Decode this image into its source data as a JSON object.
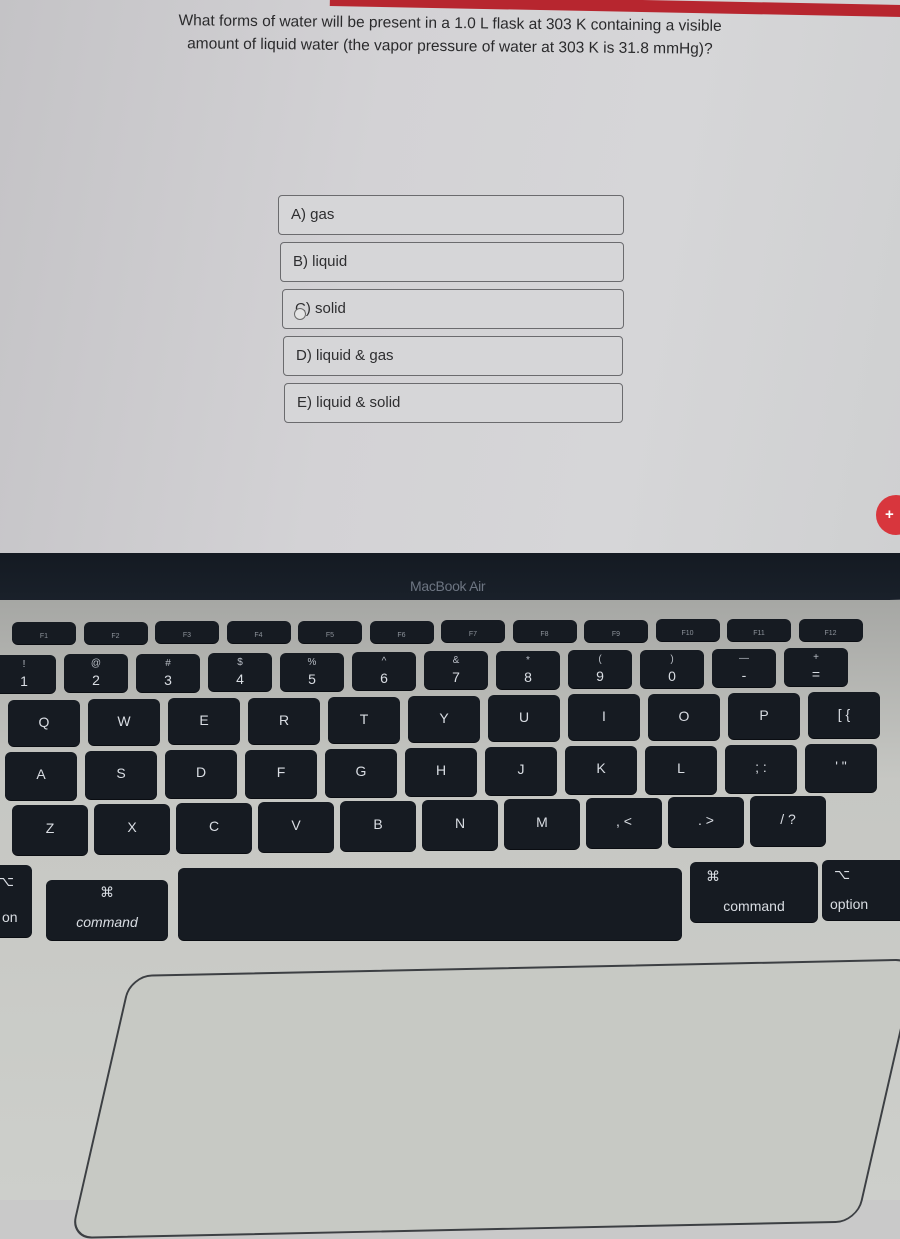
{
  "quiz": {
    "question_line1": "What forms of water will be present in a 1.0 L flask at 303 K containing a visible",
    "question_line2": "amount of liquid water (the vapor pressure of water at 303 K is 31.8 mmHg)?",
    "options": [
      {
        "label": "A) gas"
      },
      {
        "label": "B) liquid"
      },
      {
        "label": "C) solid"
      },
      {
        "label": "D) liquid & gas"
      },
      {
        "label": "E) liquid & solid"
      }
    ],
    "hovered_option": "C",
    "fab_label": "+",
    "accent_color": "#d8363d"
  },
  "laptop": {
    "brand": "MacBook Air",
    "keys": {
      "fn_row": [
        "F1",
        "F2",
        "F3",
        "F4",
        "F5",
        "F6",
        "F7",
        "F8",
        "F9",
        "F10",
        "F11",
        "F12"
      ],
      "number_row": [
        {
          "t": "1",
          "s": "!"
        },
        {
          "t": "2",
          "s": "@"
        },
        {
          "t": "3",
          "s": "#"
        },
        {
          "t": "4",
          "s": "$"
        },
        {
          "t": "5",
          "s": "%"
        },
        {
          "t": "6",
          "s": "^"
        },
        {
          "t": "7",
          "s": "&"
        },
        {
          "t": "8",
          "s": "*"
        },
        {
          "t": "9",
          "s": "("
        },
        {
          "t": "0",
          "s": ")"
        },
        {
          "t": "-",
          "s": "—"
        },
        {
          "t": "=",
          "s": "+"
        }
      ],
      "top_row": [
        "Q",
        "W",
        "E",
        "R",
        "T",
        "Y",
        "U",
        "I",
        "O",
        "P",
        "[ {"
      ],
      "home_row": [
        "A",
        "S",
        "D",
        "F",
        "G",
        "H",
        "J",
        "K",
        "L",
        "; :",
        "' \""
      ],
      "bottom_row": [
        "Z",
        "X",
        "C",
        "V",
        "B",
        "N",
        "M",
        ", <",
        ". >",
        "/ ?"
      ],
      "left_option_label": "on",
      "left_command_label": "command",
      "right_command_label": "command",
      "right_option_label": "option",
      "command_symbol": "⌘",
      "option_symbol": "⌥"
    }
  }
}
